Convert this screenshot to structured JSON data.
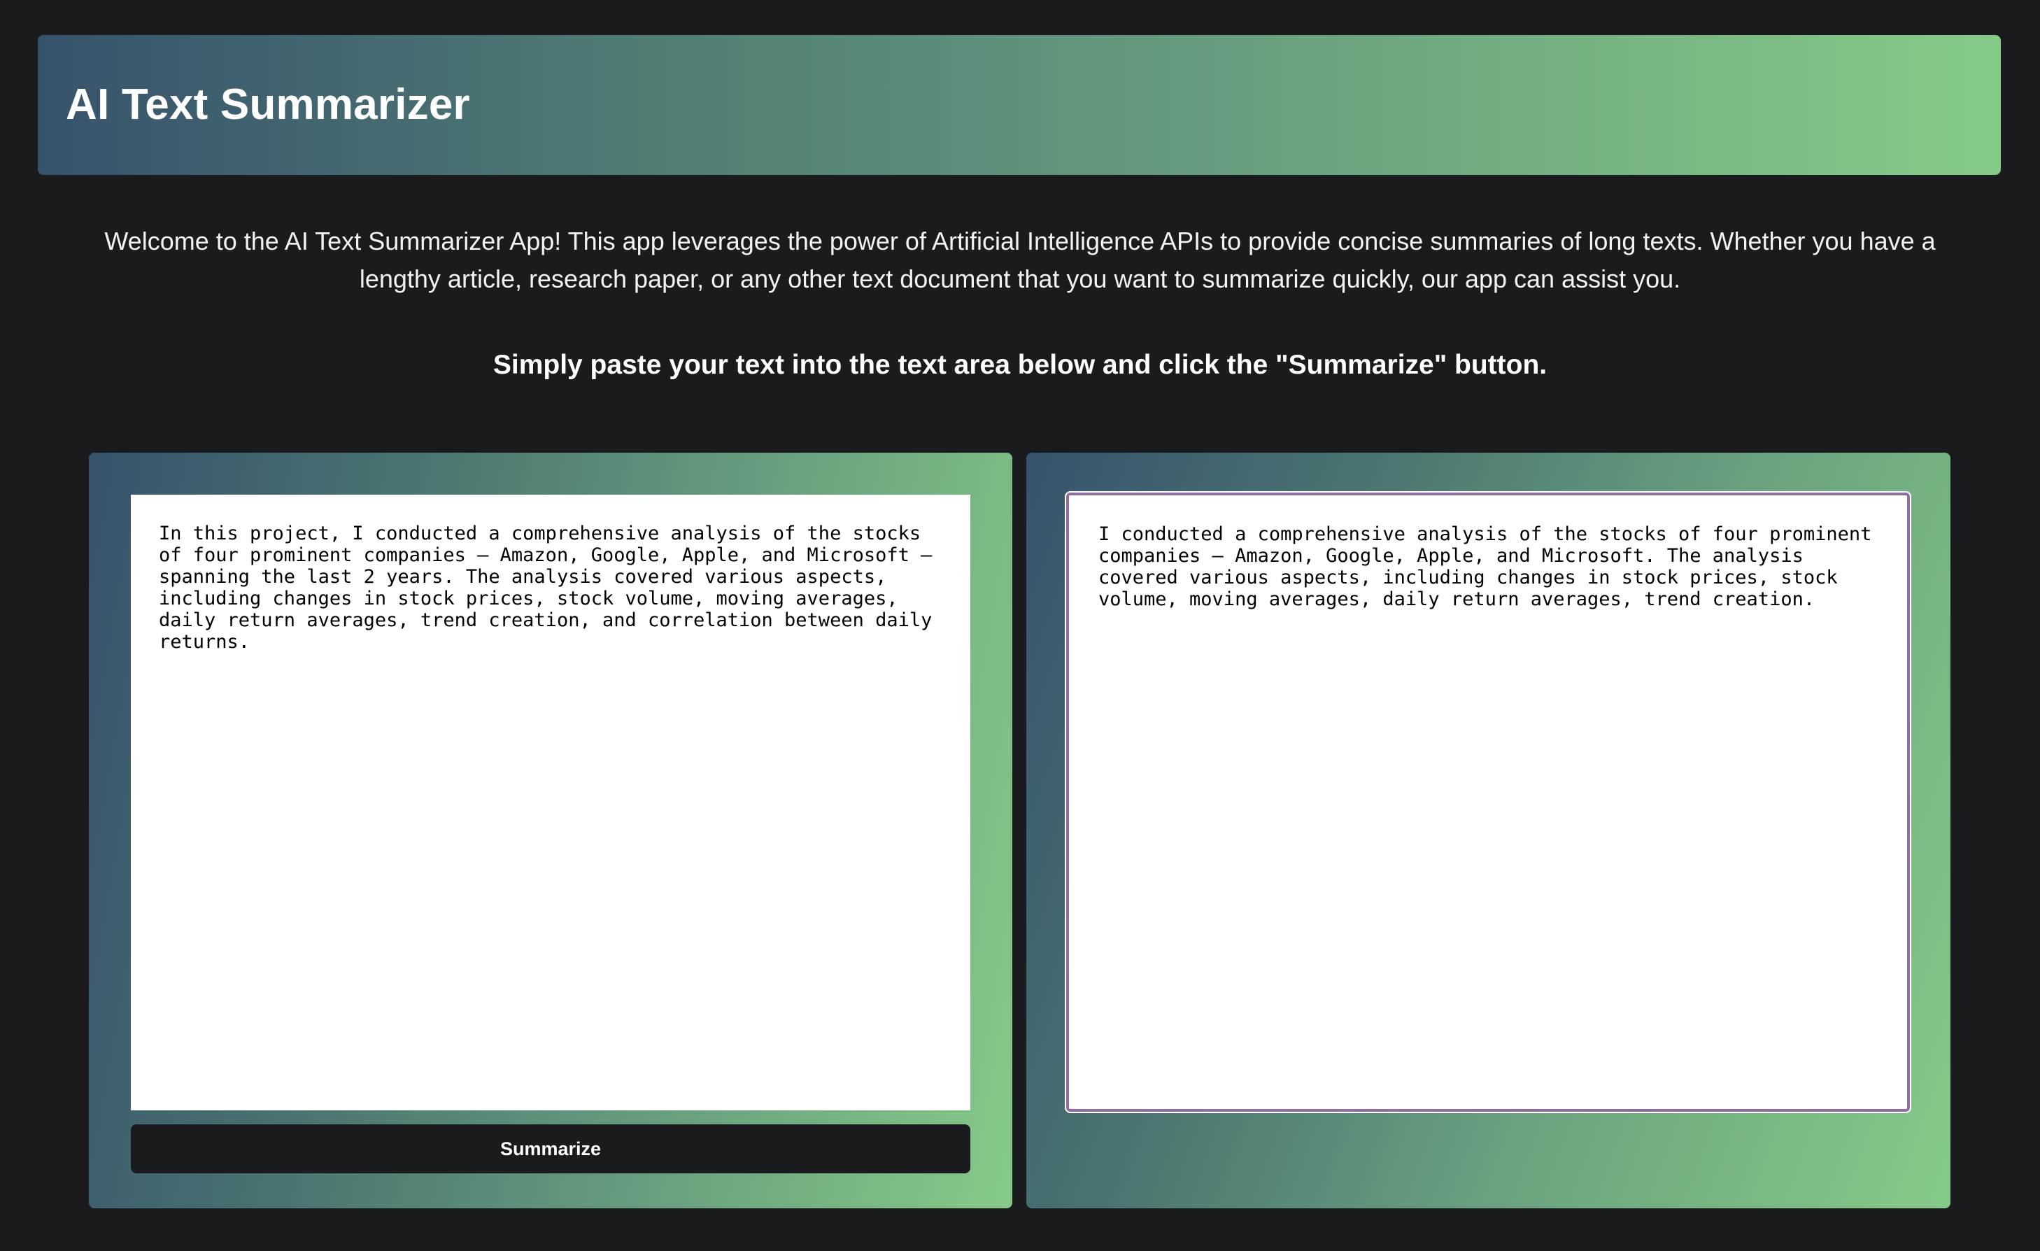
{
  "header": {
    "title": "AI Text Summarizer"
  },
  "intro": {
    "text": "Welcome to the AI Text Summarizer App! This app leverages the power of Artificial Intelligence APIs to provide concise summaries of long texts. Whether you have a lengthy article, research paper, or any other text document that you want to summarize quickly, our app can assist you."
  },
  "instruction": {
    "text": "Simply paste your text into the text area below and click the \"Summarize\" button."
  },
  "input_panel": {
    "text": "In this project, I conducted a comprehensive analysis of the stocks of four prominent companies – Amazon, Google, Apple, and Microsoft – spanning the last 2 years. The analysis covered various aspects, including changes in stock prices, stock volume, moving averages, daily return averages, trend creation, and correlation between daily returns.",
    "button_label": "Summarize"
  },
  "output_panel": {
    "text": "I conducted a comprehensive analysis of the stocks of four prominent companies – Amazon, Google, Apple, and Microsoft. The analysis covered various aspects, including changes in stock prices, stock volume, moving averages, daily return averages, trend creation."
  },
  "colors": {
    "background": "#1a1b1f",
    "gradient_start": "#37536c",
    "gradient_end": "#86ca88",
    "button_background": "#1a1b1f",
    "output_border": "#8e6f9f"
  }
}
